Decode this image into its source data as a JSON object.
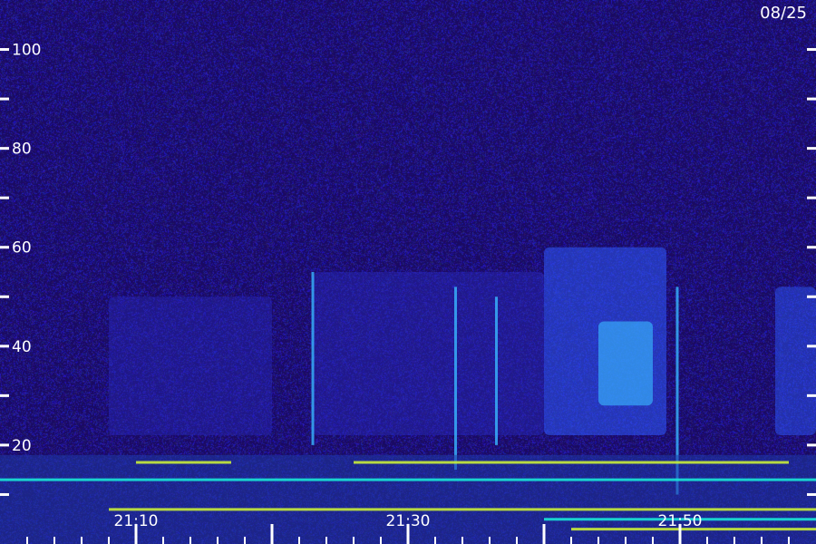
{
  "chart_data": {
    "type": "heatmap",
    "date_label": "08/25",
    "y_axis": {
      "range": [
        0,
        110
      ],
      "major_ticks": [
        20,
        40,
        60,
        80,
        100
      ],
      "major_labels": [
        "20",
        "40",
        "60",
        "80",
        "100"
      ],
      "minor_ticks": [
        10,
        30,
        50,
        70,
        90
      ]
    },
    "x_axis": {
      "labels": [
        "21:10",
        "21:30",
        "21:50"
      ],
      "label_minutes": [
        1270,
        1290,
        1310
      ],
      "range_minutes": [
        1260,
        1320
      ]
    },
    "colors": {
      "background": "#1a0a63",
      "low": "#2a2cc0",
      "mid": "#2f5cff",
      "high": "#39b7ff",
      "line_cyan": "#19e6d6",
      "line_yellow": "#c8ee3a",
      "axis": "#ffffff"
    },
    "emission_bands": [
      {
        "start_min": 1268,
        "end_min": 1280,
        "low": 22,
        "high": 50,
        "level": 0.35
      },
      {
        "start_min": 1283,
        "end_min": 1300,
        "low": 22,
        "high": 55,
        "level": 0.45
      },
      {
        "start_min": 1300,
        "end_min": 1309,
        "low": 22,
        "high": 60,
        "level": 0.7
      },
      {
        "start_min": 1304,
        "end_min": 1308,
        "low": 28,
        "high": 45,
        "level": 0.95
      },
      {
        "start_min": 1317,
        "end_min": 1320,
        "low": 22,
        "high": 52,
        "level": 0.55
      }
    ],
    "streaks": [
      {
        "minute": 1283,
        "low": 20,
        "high": 55
      },
      {
        "minute": 1293.5,
        "low": 15,
        "high": 52
      },
      {
        "minute": 1296.5,
        "low": 20,
        "high": 50
      },
      {
        "minute": 1309.8,
        "low": 10,
        "high": 52
      }
    ],
    "low_lines": [
      {
        "start_min": 1270,
        "end_min": 1277,
        "freq": 16.5,
        "color": "line_yellow"
      },
      {
        "start_min": 1286,
        "end_min": 1318,
        "freq": 16.5,
        "color": "line_yellow"
      },
      {
        "start_min": 1260,
        "end_min": 1320,
        "freq": 13,
        "color": "line_cyan"
      },
      {
        "start_min": 1268,
        "end_min": 1320,
        "freq": 7,
        "color": "line_yellow"
      },
      {
        "start_min": 1300,
        "end_min": 1320,
        "freq": 5,
        "color": "line_cyan"
      },
      {
        "start_min": 1302,
        "end_min": 1320,
        "freq": 3,
        "color": "line_yellow"
      }
    ]
  }
}
